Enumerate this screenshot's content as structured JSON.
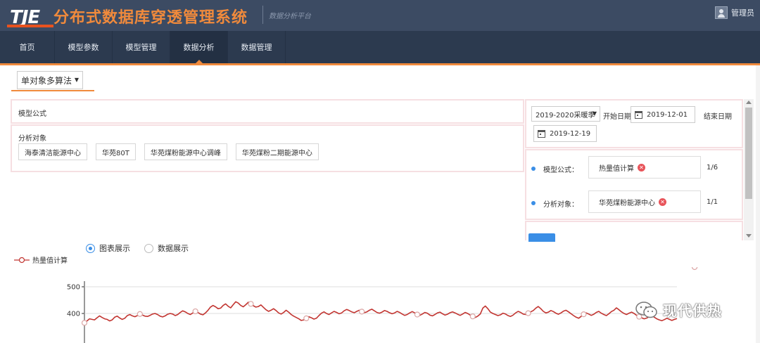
{
  "header": {
    "logo_text": "TJE",
    "title": "分布式数据库穿透管理系统",
    "subtitle": "数据分析平台",
    "user_label": "管理员"
  },
  "nav": {
    "items": [
      {
        "label": "首页"
      },
      {
        "label": "模型参数"
      },
      {
        "label": "模型管理"
      },
      {
        "label": "数据分析"
      },
      {
        "label": "数据管理"
      }
    ],
    "active_index": 3
  },
  "algo_select": {
    "value": "单对象多算法"
  },
  "formula_panel": {
    "label": "模型公式"
  },
  "target_panel": {
    "label": "分析对象",
    "chips": [
      "海泰清洁能源中心",
      "华苑80T",
      "华苑煤粉能源中心调峰",
      "华苑煤粉二期能源中心"
    ]
  },
  "filters": {
    "season": "2019-2020采暖季",
    "start_label": "开始日期",
    "start_date": "2019-12-01",
    "end_label": "结束日期",
    "end_date": "2019-12-19"
  },
  "selection": {
    "formula_label": "模型公式：",
    "formula_value": "热量值计算",
    "formula_count": "1/6",
    "target_label": "分析对象：",
    "target_value": "华苑煤粉能源中心",
    "target_count": "1/1"
  },
  "view_toggle": {
    "chart_label": "图表展示",
    "data_label": "数据展示",
    "selected": "chart"
  },
  "watermark": "现代供热",
  "colors": {
    "header_bg": "#3c4b63",
    "nav_bg": "#2c3a4f",
    "accent": "#f08a3c",
    "series": "#c23531",
    "primary": "#3a8ee6"
  },
  "chart_data": {
    "type": "line",
    "title": "",
    "xlabel": "",
    "ylabel": "",
    "ylim": [
      300,
      500
    ],
    "yticks": [
      400,
      500
    ],
    "series": [
      {
        "name": "热量值计算",
        "values": [
          365,
          372,
          380,
          378,
          376,
          384,
          391,
          385,
          380,
          378,
          372,
          376,
          386,
          390,
          383,
          378,
          382,
          392,
          396,
          391,
          388,
          392,
          398,
          394,
          390,
          389,
          393,
          398,
          400,
          396,
          390,
          387,
          391,
          397,
          400,
          398,
          392,
          396,
          404,
          410,
          406,
          400,
          396,
          402,
          408,
          404,
          398,
          395,
          402,
          412,
          424,
          430,
          425,
          418,
          420,
          430,
          436,
          427,
          421,
          433,
          444,
          439,
          430,
          425,
          433,
          442,
          436,
          429,
          424,
          426,
          432,
          423,
          414,
          408,
          412,
          418,
          411,
          402,
          398,
          404,
          412,
          405,
          396,
          390,
          385,
          380,
          374,
          376,
          382,
          388,
          384,
          379,
          382,
          392,
          401,
          406,
          400,
          396,
          402,
          408,
          404,
          399,
          402,
          410,
          415,
          411,
          406,
          403,
          408,
          412,
          407,
          403,
          406,
          412,
          416,
          410,
          404,
          401,
          405,
          411,
          408,
          403,
          399,
          402,
          408,
          404,
          398,
          393,
          396,
          402,
          407,
          402,
          396,
          393,
          398,
          404,
          401,
          394,
          391,
          396,
          402,
          405,
          399,
          394,
          397,
          403,
          406,
          402,
          397,
          393,
          398,
          404,
          400,
          394,
          389,
          385,
          390,
          398,
          420,
          428,
          418,
          405,
          400,
          396,
          392,
          395,
          401,
          398,
          392,
          389,
          394,
          402,
          408,
          404,
          398,
          396,
          401,
          406,
          411,
          420,
          426,
          418,
          408,
          402,
          405,
          411,
          407,
          401,
          397,
          402,
          409,
          412,
          406,
          399,
          392,
          386,
          382,
          389,
          397,
          402,
          398,
          393,
          397,
          404,
          408,
          401,
          396,
          392,
          399,
          407,
          412,
          421,
          414,
          406,
          400,
          396,
          401,
          405,
          400,
          393,
          388,
          384,
          380,
          383,
          388,
          392,
          386,
          380,
          376,
          373,
          377,
          382,
          378,
          374,
          378,
          381
        ],
        "markers": [
          0,
          22,
          44,
          66,
          88,
          110,
          132,
          154,
          176,
          198,
          220,
          242
        ]
      }
    ],
    "legend": "top-left",
    "grid": true
  }
}
